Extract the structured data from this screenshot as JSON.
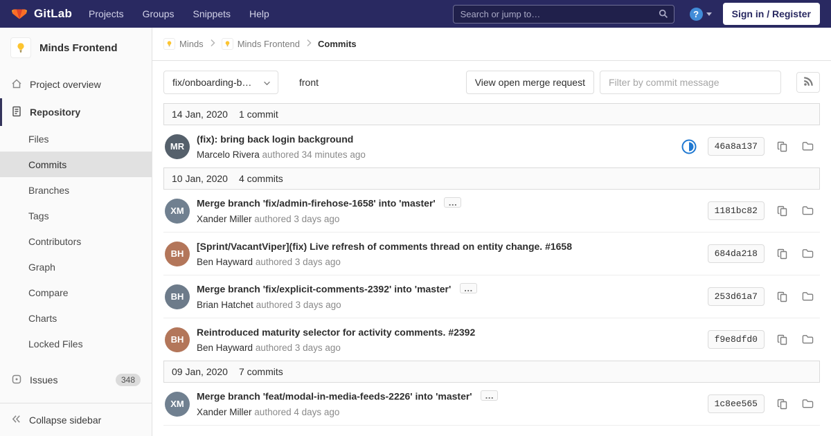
{
  "theme": {
    "navbar_bg": "#292961",
    "accent_blue": "#1f78d1",
    "brand_orange": "#fc6d26"
  },
  "navbar": {
    "logo_text": "GitLab",
    "menu": [
      {
        "label": "Projects"
      },
      {
        "label": "Groups"
      },
      {
        "label": "Snippets"
      },
      {
        "label": "Help"
      }
    ],
    "search_placeholder": "Search or jump to…",
    "help_icon_glyph": "?",
    "sign_in_label": "Sign in / Register"
  },
  "sidebar": {
    "project": {
      "name": "Minds Frontend"
    },
    "overview_label": "Project overview",
    "repository_label": "Repository",
    "repo_subitems": [
      "Files",
      "Commits",
      "Branches",
      "Tags",
      "Contributors",
      "Graph",
      "Compare",
      "Charts",
      "Locked Files"
    ],
    "issues": {
      "label": "Issues",
      "count": "348"
    },
    "collapse_label": "Collapse sidebar"
  },
  "breadcrumb": {
    "items": [
      {
        "label": "Minds"
      },
      {
        "label": "Minds Frontend"
      },
      {
        "label": "Commits"
      }
    ]
  },
  "toolbar": {
    "branch_selector": "fix/onboarding-b…",
    "path": "front",
    "mr_button": "View open merge request",
    "filter_placeholder": "Filter by commit message"
  },
  "commits": {
    "expand_label": "…",
    "groups": [
      {
        "date": "14 Jan, 2020",
        "count_label": "1 commit",
        "commits": [
          {
            "title": "(fix): bring back login background",
            "author": "Marcelo Rivera",
            "meta": "authored 34 minutes ago",
            "sha": "46a8a137",
            "initials": "MR",
            "avatar_style": "background:#55606b"
          }
        ]
      },
      {
        "date": "10 Jan, 2020",
        "count_label": "4 commits",
        "commits": [
          {
            "title": "Merge branch 'fix/admin-firehose-1658' into 'master'",
            "author": "Xander Miller",
            "meta": "authored 3 days ago",
            "sha": "1181bc82",
            "initials": "XM",
            "avatar_style": "background:#708090"
          },
          {
            "title": "[Sprint/VacantViper](fix) Live refresh of comments thread on entity change. #1658",
            "author": "Ben Hayward",
            "meta": "authored 3 days ago",
            "sha": "684da218",
            "initials": "BH",
            "avatar_style": "background:#b3765a"
          },
          {
            "title": "Merge branch 'fix/explicit-comments-2392' into 'master'",
            "author": "Brian Hatchet",
            "meta": "authored 3 days ago",
            "sha": "253d61a7",
            "initials": "BH",
            "avatar_style": "background:#6d7b8a"
          },
          {
            "title": "Reintroduced maturity selector for activity comments. #2392",
            "author": "Ben Hayward",
            "meta": "authored 3 days ago",
            "sha": "f9e8dfd0",
            "initials": "BH",
            "avatar_style": "background:#b3765a"
          }
        ]
      },
      {
        "date": "09 Jan, 2020",
        "count_label": "7 commits",
        "commits": [
          {
            "title": "Merge branch 'feat/modal-in-media-feeds-2226' into 'master'",
            "author": "Xander Miller",
            "meta": "authored 4 days ago",
            "sha": "1c8ee565",
            "initials": "XM",
            "avatar_style": "background:#708090"
          }
        ]
      }
    ]
  }
}
